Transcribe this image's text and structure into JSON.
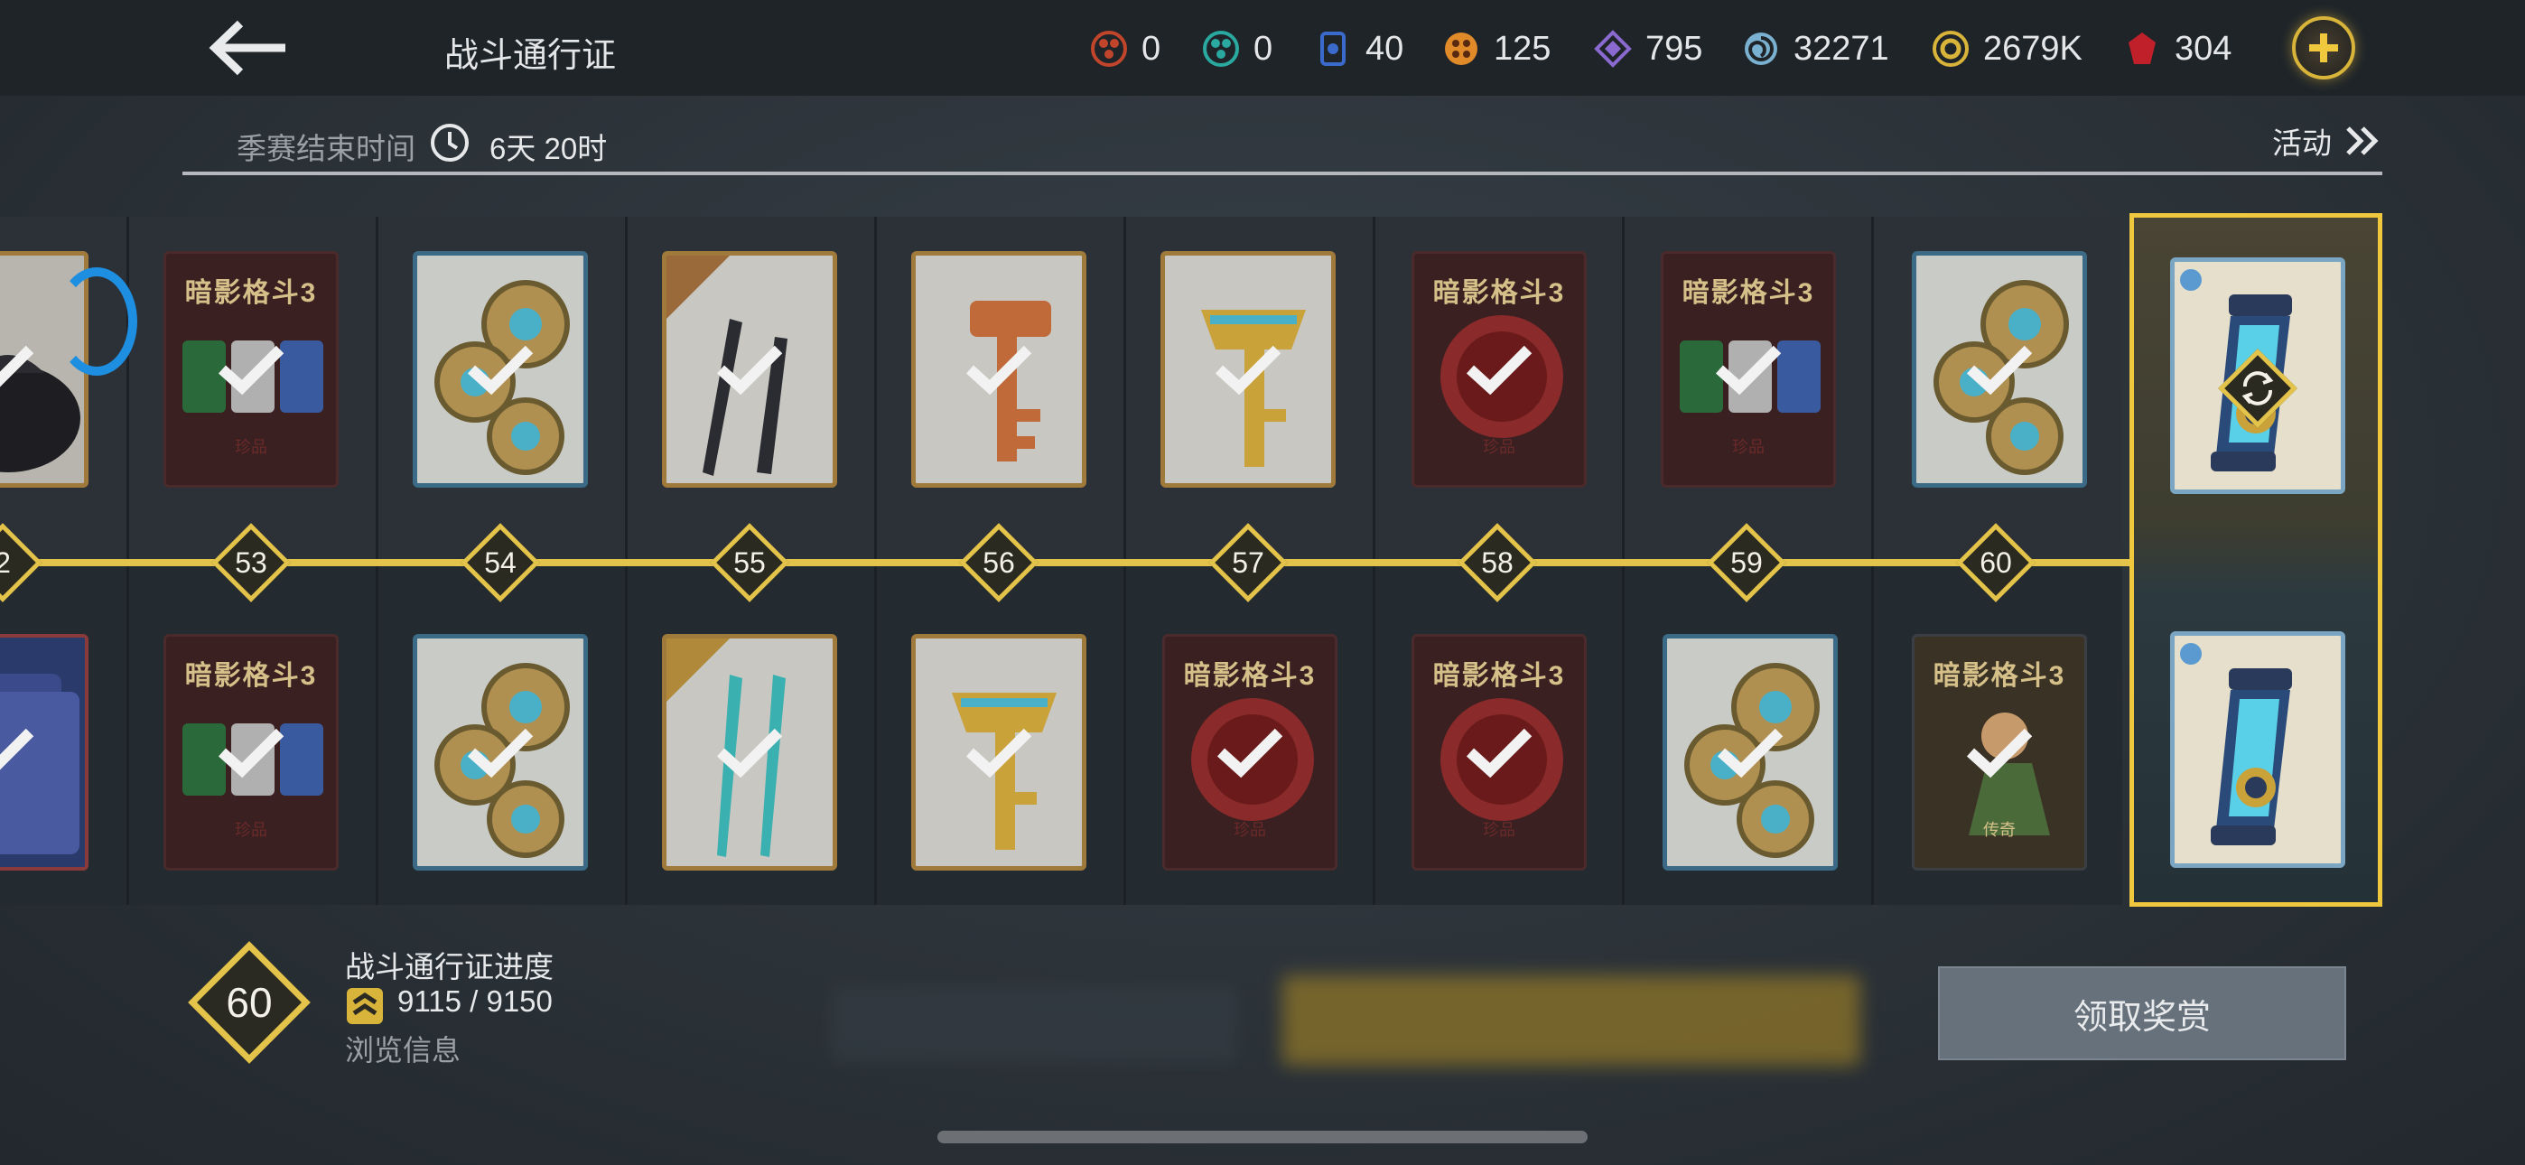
{
  "header": {
    "title": "战斗通行证",
    "currencies": [
      {
        "icon": "red-token-icon",
        "value": "0",
        "color": "#c0452a"
      },
      {
        "icon": "teal-token-icon",
        "value": "0",
        "color": "#2aa9a0"
      },
      {
        "icon": "blue-card-icon",
        "value": "40",
        "color": "#3a6acb"
      },
      {
        "icon": "orange-token-icon",
        "value": "125",
        "color": "#e08a2a"
      },
      {
        "icon": "purple-diamond-icon",
        "value": "795",
        "color": "#8a6ad0"
      },
      {
        "icon": "spiral-icon",
        "value": "32271",
        "color": "#7ab0d0"
      },
      {
        "icon": "gold-coin-icon",
        "value": "2679K",
        "color": "#d9b43a"
      },
      {
        "icon": "ruby-icon",
        "value": "304",
        "color": "#c0202a"
      }
    ]
  },
  "season": {
    "label": "季赛结束时间",
    "time_left": "6天 20时",
    "event_label": "活动"
  },
  "track": {
    "levels": [
      "2",
      "53",
      "54",
      "55",
      "56",
      "57",
      "58",
      "59",
      "60"
    ],
    "top_rewards": [
      {
        "kind": "bag",
        "claimed": true
      },
      {
        "kind": "potions",
        "caption": "珍品",
        "claimed": true
      },
      {
        "kind": "coins",
        "claimed": true
      },
      {
        "kind": "blades",
        "claimed": true
      },
      {
        "kind": "key-copper",
        "claimed": true
      },
      {
        "kind": "key-gold",
        "claimed": true
      },
      {
        "kind": "seal",
        "caption": "珍品",
        "claimed": true
      },
      {
        "kind": "potions",
        "caption": "珍品",
        "claimed": true
      },
      {
        "kind": "coins",
        "claimed": true
      }
    ],
    "bottom_rewards": [
      {
        "kind": "cards",
        "claimed": true
      },
      {
        "kind": "potions",
        "caption": "珍品",
        "claimed": true
      },
      {
        "kind": "coins",
        "claimed": true
      },
      {
        "kind": "spears",
        "claimed": true
      },
      {
        "kind": "key-gold",
        "claimed": true
      },
      {
        "kind": "seal",
        "caption": "珍品",
        "claimed": true
      },
      {
        "kind": "seal",
        "caption": "珍品",
        "claimed": true
      },
      {
        "kind": "coins",
        "claimed": true
      },
      {
        "kind": "hero-poster",
        "caption": "传奇",
        "claimed": true
      }
    ],
    "logo_text": "暗影格斗3",
    "final_icon": "repeat-icon"
  },
  "progress": {
    "level": "60",
    "title": "战斗通行证进度",
    "value": "9115 / 9150",
    "fraction": 0.9962,
    "browse_label": "浏览信息"
  },
  "claim_button": "领取奖赏"
}
